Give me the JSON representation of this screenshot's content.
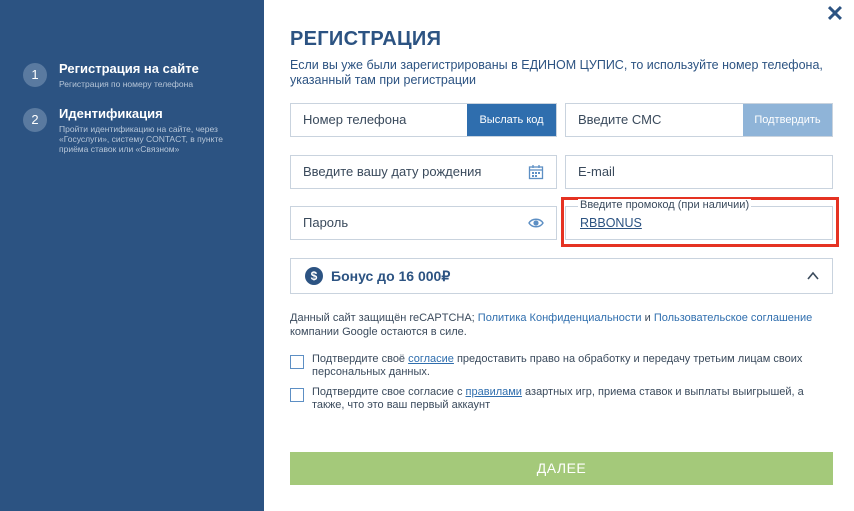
{
  "sidebar": {
    "steps": [
      {
        "num": "1",
        "title": "Регистрация на сайте",
        "sub": "Регистрация по номеру телефона"
      },
      {
        "num": "2",
        "title": "Идентификация",
        "sub": "Пройти идентификацию на сайте, через «Госуслуги», систему CONTACT, в пункте приёма ставок или «Связном»"
      }
    ]
  },
  "header": {
    "close": "✕",
    "title": "РЕГИСТРАЦИЯ",
    "intro": "Если вы уже были зарегистрированы в ЕДИНОМ ЦУПИС, то используйте номер телефона, указанный там при регистрации"
  },
  "form": {
    "phone_label": "Номер телефона",
    "send_code": "Выслать код",
    "sms_label": "Введите СМС",
    "confirm": "Подтвердить",
    "birthdate_label": "Введите вашу дату рождения",
    "email_label": "E-mail",
    "password_label": "Пароль",
    "promo_label": "Введите промокод (при наличии)",
    "promo_value": "RBBONUS",
    "bonus_label": "Бонус до 16 000₽"
  },
  "recaptcha": {
    "prefix": "Данный сайт защищён reCAPTCHA; ",
    "privacy": "Политика Конфиденциальности",
    "and": " и ",
    "terms": "Пользовательское соглашение",
    "suffix": " компании Google остаются в силе."
  },
  "checks": [
    {
      "before": "Подтвердите своё ",
      "link": "согласие",
      "after": " предоставить право на обработку и передачу третьим лицам своих персональных данных."
    },
    {
      "before": "Подтвердите свое согласие с ",
      "link": "правилами",
      "after": " азартных игр, приема ставок и выплаты выигрышей, а также, что это ваш первый аккаунт"
    }
  ],
  "submit": "ДАЛЕЕ",
  "colors": {
    "sidebar": "#2c5382",
    "accent": "#2f6eae",
    "highlight": "#e53222",
    "submit": "#a4c97a"
  }
}
